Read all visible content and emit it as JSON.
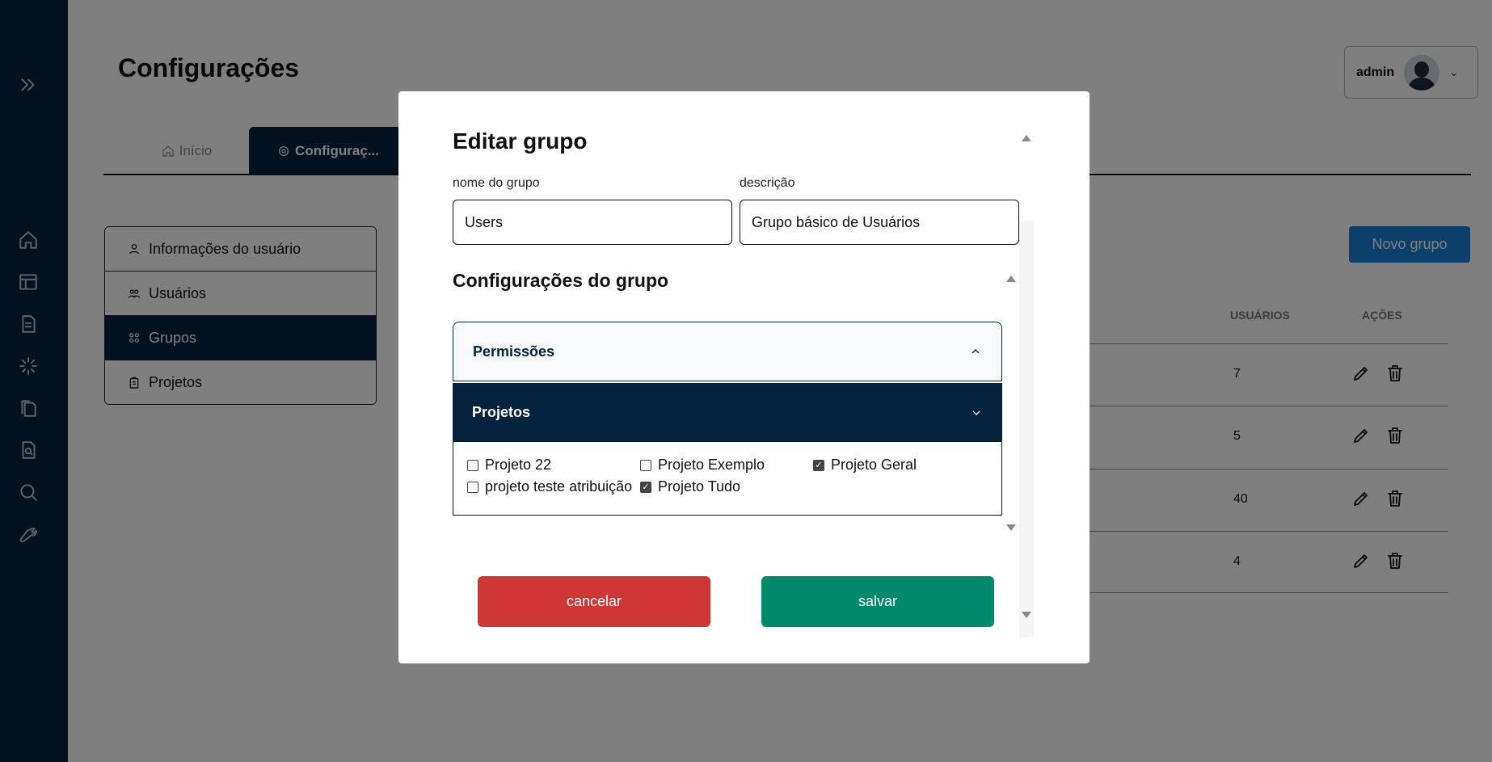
{
  "page": {
    "title": "Configurações",
    "user": {
      "name": "admin"
    },
    "tabs": [
      {
        "label": "Início"
      },
      {
        "label": "Configuraç..."
      }
    ],
    "menu": [
      {
        "label": "Informações do usuário"
      },
      {
        "label": "Usuários"
      },
      {
        "label": "Grupos",
        "active": true
      },
      {
        "label": "Projetos"
      }
    ],
    "new_group_label": "Novo grupo",
    "table": {
      "headers": [
        "USUÁRIOS",
        "AÇÕES"
      ],
      "rows": [
        {
          "count": "7"
        },
        {
          "count": "5"
        },
        {
          "count": "40"
        },
        {
          "count": "4"
        }
      ]
    }
  },
  "modal": {
    "title": "Editar grupo",
    "name_label": "nome do grupo",
    "name_value": "Users",
    "desc_label": "descrição",
    "desc_value": "Grupo básico de Usuários",
    "section_title": "Configurações do grupo",
    "accordions": [
      {
        "label": "Permissões"
      },
      {
        "label": "Projetos"
      }
    ],
    "projects": [
      {
        "label": "Projeto 22",
        "checked": false
      },
      {
        "label": "Projeto Exemplo",
        "checked": false
      },
      {
        "label": "Projeto Geral",
        "checked": true
      },
      {
        "label": "projeto teste atribuição",
        "checked": false
      },
      {
        "label": "Projeto Tudo",
        "checked": true
      }
    ],
    "cancel_label": "cancelar",
    "save_label": "salvar"
  },
  "colors": {
    "navy": "#02223e",
    "primary_blue": "#1a7fd6",
    "danger": "#cf3636",
    "success": "#00896b"
  }
}
